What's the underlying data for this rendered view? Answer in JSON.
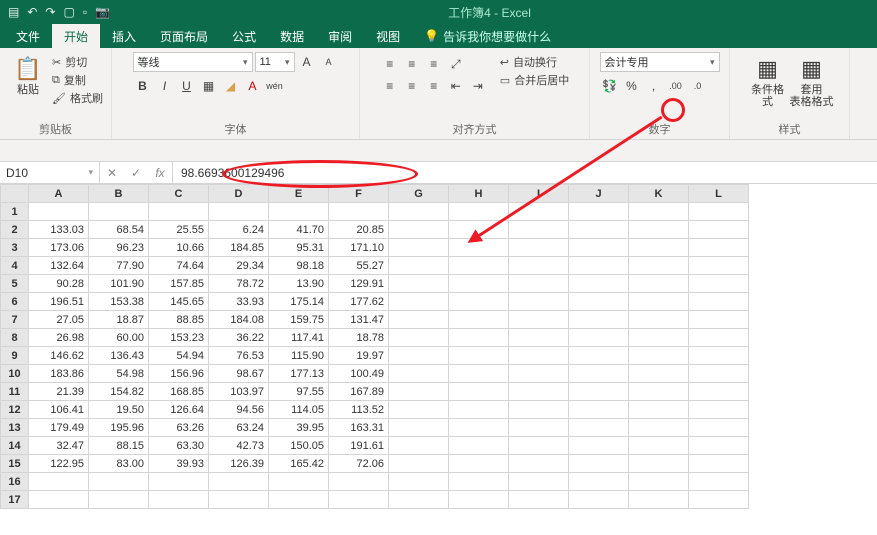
{
  "titlebar": {
    "title": "工作簿4 - Excel"
  },
  "tabs": [
    "文件",
    "开始",
    "插入",
    "页面布局",
    "公式",
    "数据",
    "审阅",
    "视图"
  ],
  "active_tab_index": 1,
  "tell_me": "告诉我你想要做什么",
  "ribbon": {
    "clipboard": {
      "label": "剪贴板",
      "paste": "粘贴",
      "cut": "剪切",
      "copy": "复制",
      "format_painter": "格式刷"
    },
    "font": {
      "label": "字体",
      "name": "等线",
      "size": "11"
    },
    "alignment": {
      "label": "对齐方式",
      "wrap": "自动换行",
      "merge": "合并后居中"
    },
    "number": {
      "label": "数字",
      "format": "会计专用"
    },
    "styles": {
      "label": "样式",
      "conditional": "条件格式",
      "table": "套用\n表格格式"
    }
  },
  "formula_bar": {
    "reference": "D10",
    "value": "98.6693600129496"
  },
  "columns": [
    "A",
    "B",
    "C",
    "D",
    "E",
    "F",
    "G",
    "H",
    "I",
    "J",
    "K",
    "L"
  ],
  "row_count": 17,
  "cells": {
    "2": [
      "133.03",
      "68.54",
      "25.55",
      "6.24",
      "41.70",
      "20.85"
    ],
    "3": [
      "173.06",
      "96.23",
      "10.66",
      "184.85",
      "95.31",
      "171.10"
    ],
    "4": [
      "132.64",
      "77.90",
      "74.64",
      "29.34",
      "98.18",
      "55.27"
    ],
    "5": [
      "90.28",
      "101.90",
      "157.85",
      "78.72",
      "13.90",
      "129.91"
    ],
    "6": [
      "196.51",
      "153.38",
      "145.65",
      "33.93",
      "175.14",
      "177.62"
    ],
    "7": [
      "27.05",
      "18.87",
      "88.85",
      "184.08",
      "159.75",
      "131.47"
    ],
    "8": [
      "26.98",
      "60.00",
      "153.23",
      "36.22",
      "117.41",
      "18.78"
    ],
    "9": [
      "146.62",
      "136.43",
      "54.94",
      "76.53",
      "115.90",
      "19.97"
    ],
    "10": [
      "183.86",
      "54.98",
      "156.96",
      "98.67",
      "177.13",
      "100.49"
    ],
    "11": [
      "21.39",
      "154.82",
      "168.85",
      "103.97",
      "97.55",
      "167.89"
    ],
    "12": [
      "106.41",
      "19.50",
      "126.64",
      "94.56",
      "114.05",
      "113.52"
    ],
    "13": [
      "179.49",
      "195.96",
      "63.26",
      "63.24",
      "39.95",
      "163.31"
    ],
    "14": [
      "32.47",
      "88.15",
      "63.30",
      "42.73",
      "150.05",
      "191.61"
    ],
    "15": [
      "122.95",
      "83.00",
      "39.93",
      "126.39",
      "165.42",
      "72.06"
    ]
  }
}
